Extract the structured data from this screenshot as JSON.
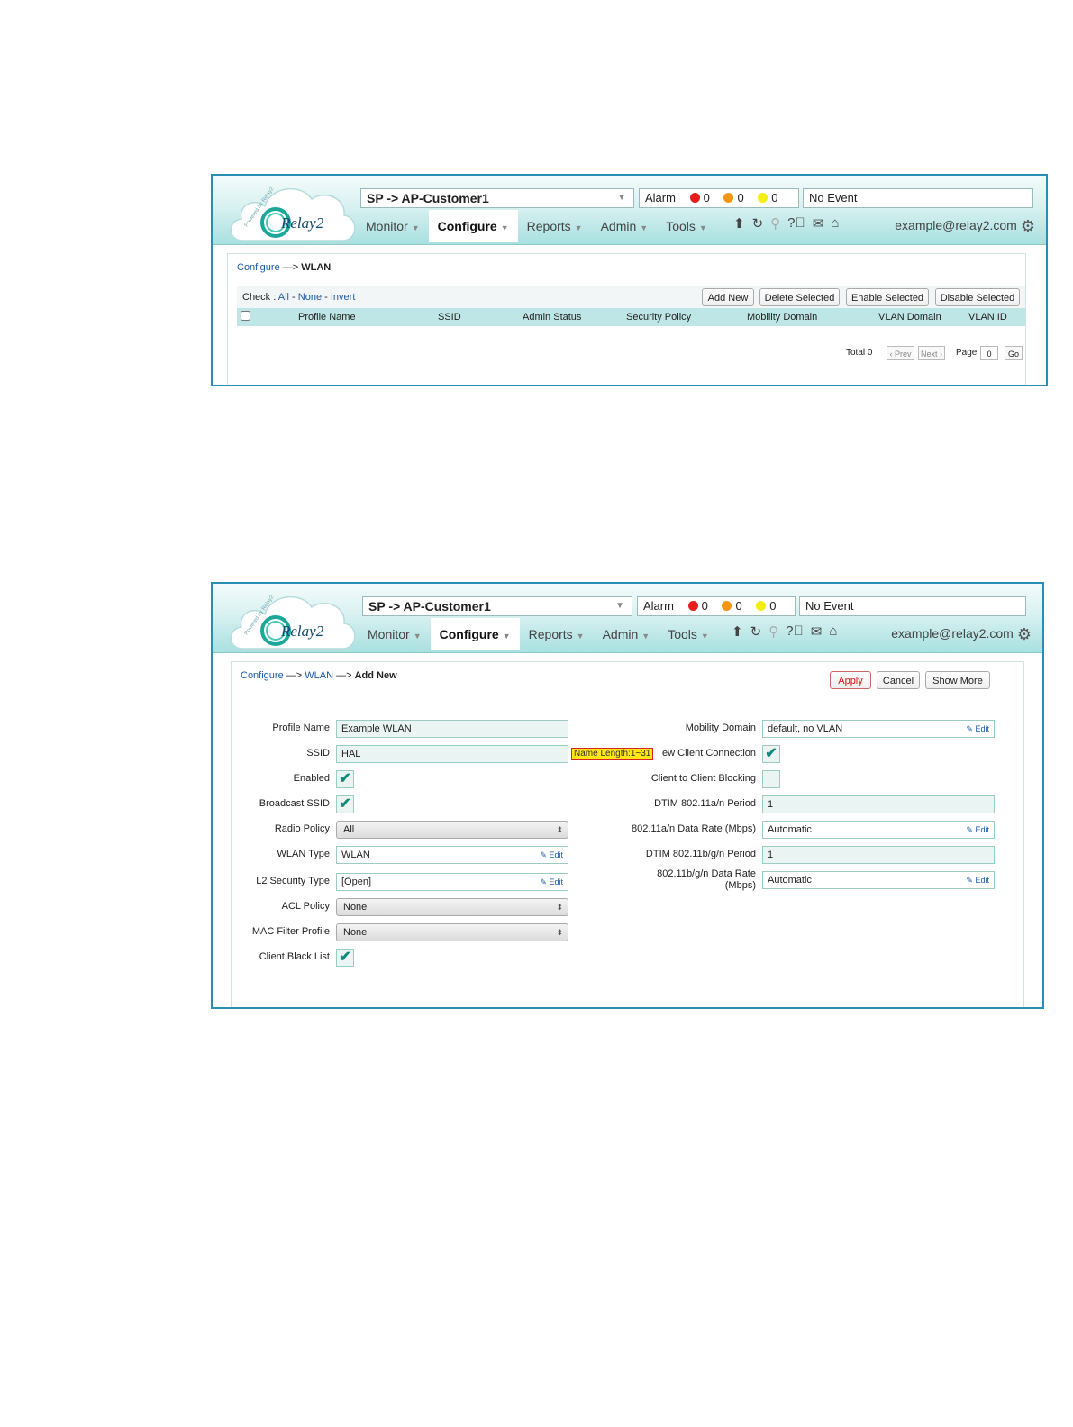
{
  "header": {
    "customer": "SP -> AP-Customer1",
    "alarm_label": "Alarm",
    "alarm_counts": {
      "red": "0",
      "orange": "0",
      "yellow": "0"
    },
    "alarm_colors": {
      "red": "#e81e1e",
      "orange": "#f59514",
      "yellow": "#f2ee10"
    },
    "event": "No Event",
    "nav": [
      "Monitor",
      "Configure",
      "Reports",
      "Admin",
      "Tools"
    ],
    "active_tab": "Configure",
    "user": "example@relay2.com",
    "logo_text": "Relay2",
    "logo_tagline": "Powered by Relay2",
    "tool_icons": [
      "upload-icon",
      "refresh-icon",
      "search-icon",
      "help-icon",
      "mail-icon",
      "device-icon"
    ]
  },
  "wlan_list": {
    "breadcrumb": {
      "root": "Configure",
      "sep": "—>",
      "current": "WLAN"
    },
    "check": {
      "label": "Check :",
      "all": "All",
      "none": "None",
      "invert": "Invert",
      "dash": "-"
    },
    "buttons": [
      "Add New",
      "Delete Selected",
      "Enable Selected",
      "Disable Selected"
    ],
    "columns": [
      "Profile Name",
      "SSID",
      "Admin Status",
      "Security Policy",
      "Mobility Domain",
      "VLAN Domain",
      "VLAN ID"
    ],
    "pager": {
      "total": "Total 0",
      "prev": "‹ Prev",
      "next": "Next ›",
      "page_label": "Page",
      "page": "0",
      "go": "Go"
    }
  },
  "wlan_add": {
    "breadcrumb": {
      "root": "Configure",
      "mid": "WLAN",
      "sep": "—>",
      "current": "Add New"
    },
    "buttons": {
      "apply": "Apply",
      "cancel": "Cancel",
      "show_more": "Show More"
    },
    "edit": "Edit",
    "left": {
      "profile_name": {
        "label": "Profile Name",
        "value": "Example WLAN"
      },
      "ssid": {
        "label": "SSID",
        "value": "HAL",
        "tooltip": "Name Length:1~31"
      },
      "enabled": {
        "label": "Enabled",
        "checked": true
      },
      "broadcast_ssid": {
        "label": "Broadcast SSID",
        "checked": true
      },
      "radio_policy": {
        "label": "Radio Policy",
        "value": "All"
      },
      "wlan_type": {
        "label": "WLAN Type",
        "value": "WLAN"
      },
      "l2_security": {
        "label": "L2 Security Type",
        "value": "[Open]"
      },
      "acl_policy": {
        "label": "ACL Policy",
        "value": "None"
      },
      "mac_filter": {
        "label": "MAC Filter Profile",
        "value": "None"
      },
      "client_black_list": {
        "label": "Client Black List",
        "checked": true
      }
    },
    "right": {
      "mobility_domain": {
        "label": "Mobility Domain",
        "value": "default, no VLAN"
      },
      "new_client": {
        "label": "ew Client Connection",
        "checked": true
      },
      "client_blocking": {
        "label": "Client to Client Blocking",
        "checked": false
      },
      "dtim_a": {
        "label": "DTIM 802.11a/n Period",
        "value": "1"
      },
      "rate_a": {
        "label": "802.11a/n Data Rate (Mbps)",
        "value": "Automatic"
      },
      "dtim_b": {
        "label": "DTIM 802.11b/g/n Period",
        "value": "1"
      },
      "rate_b_line1": "802.11b/g/n Data Rate",
      "rate_b_line2": "(Mbps)",
      "rate_b_value": "Automatic"
    }
  }
}
